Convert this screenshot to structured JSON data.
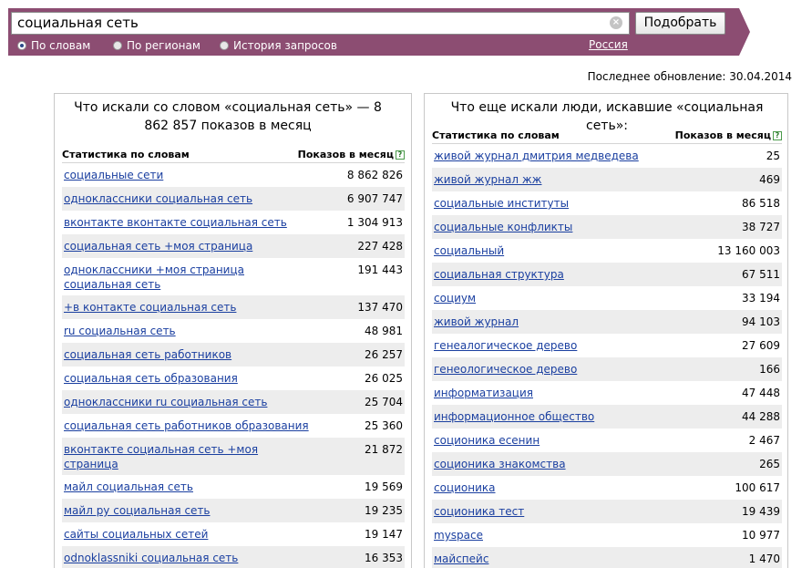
{
  "search": {
    "value": "социальная сеть",
    "clear_glyph": "×",
    "submit_label": "Подобрать"
  },
  "modes": [
    {
      "label": "По словам",
      "checked": true
    },
    {
      "label": "По регионам",
      "checked": false
    },
    {
      "label": "История запросов",
      "checked": false
    }
  ],
  "region": "Россия",
  "last_update": "Последнее обновление: 30.04.2014",
  "left_panel": {
    "title": "Что искали со словом «социальная сеть» — 8 862 857 показов в месяц",
    "col_phrase": "Статистика по словам",
    "col_count": "Показов в месяц",
    "help_glyph": "?",
    "rows": [
      {
        "phrase": "социальные сети",
        "count": "8 862 826"
      },
      {
        "phrase": "одноклассники социальная сеть",
        "count": "6 907 747"
      },
      {
        "phrase": "вконтакте вконтакте социальная сеть",
        "count": "1 304 913"
      },
      {
        "phrase": "социальная сеть +моя страница",
        "count": "227 428"
      },
      {
        "phrase": "одноклассники +моя страница социальная сеть",
        "count": "191 443"
      },
      {
        "phrase": "+в контакте социальная сеть",
        "count": "137 470"
      },
      {
        "phrase": "ru социальная сеть",
        "count": "48 981"
      },
      {
        "phrase": "социальная сеть работников",
        "count": "26 257"
      },
      {
        "phrase": "социальная сеть образования",
        "count": "26 025"
      },
      {
        "phrase": "одноклассники ru социальная сеть",
        "count": "25 704"
      },
      {
        "phrase": "социальная сеть работников образования",
        "count": "25 360"
      },
      {
        "phrase": "вконтакте социальная сеть +моя страница",
        "count": "21 872"
      },
      {
        "phrase": "майл социальная сеть",
        "count": "19 569"
      },
      {
        "phrase": "майл ру социальная сеть",
        "count": "19 235"
      },
      {
        "phrase": "сайты социальных сетей",
        "count": "19 147"
      },
      {
        "phrase": "odnoklassniki социальная сеть",
        "count": "16 353"
      }
    ]
  },
  "right_panel": {
    "title": "Что еще искали люди, искавшие «социальная сеть»:",
    "col_phrase": "Статистика по словам",
    "col_count": "Показов в месяц",
    "help_glyph": "?",
    "rows": [
      {
        "phrase": "живой журнал дмитрия медведева",
        "count": "25"
      },
      {
        "phrase": "живой журнал жж",
        "count": "469"
      },
      {
        "phrase": "социальные институты",
        "count": "86 518"
      },
      {
        "phrase": "социальные конфликты",
        "count": "38 727"
      },
      {
        "phrase": "социальный",
        "count": "13 160 003"
      },
      {
        "phrase": "социальная структура",
        "count": "67 511"
      },
      {
        "phrase": "социум",
        "count": "33 194"
      },
      {
        "phrase": "живой журнал",
        "count": "94 103"
      },
      {
        "phrase": "генеалогическое дерево",
        "count": "27 609"
      },
      {
        "phrase": "генеологическое дерево",
        "count": "166"
      },
      {
        "phrase": "информатизация",
        "count": "47 448"
      },
      {
        "phrase": "информационное общество",
        "count": "44 288"
      },
      {
        "phrase": "соционика есенин",
        "count": "2 467"
      },
      {
        "phrase": "соционика знакомства",
        "count": "265"
      },
      {
        "phrase": "соционика",
        "count": "100 617"
      },
      {
        "phrase": "соционика тест",
        "count": "19 439"
      },
      {
        "phrase": "myspace",
        "count": "10 977"
      },
      {
        "phrase": "майспейс",
        "count": "1 470"
      }
    ]
  }
}
